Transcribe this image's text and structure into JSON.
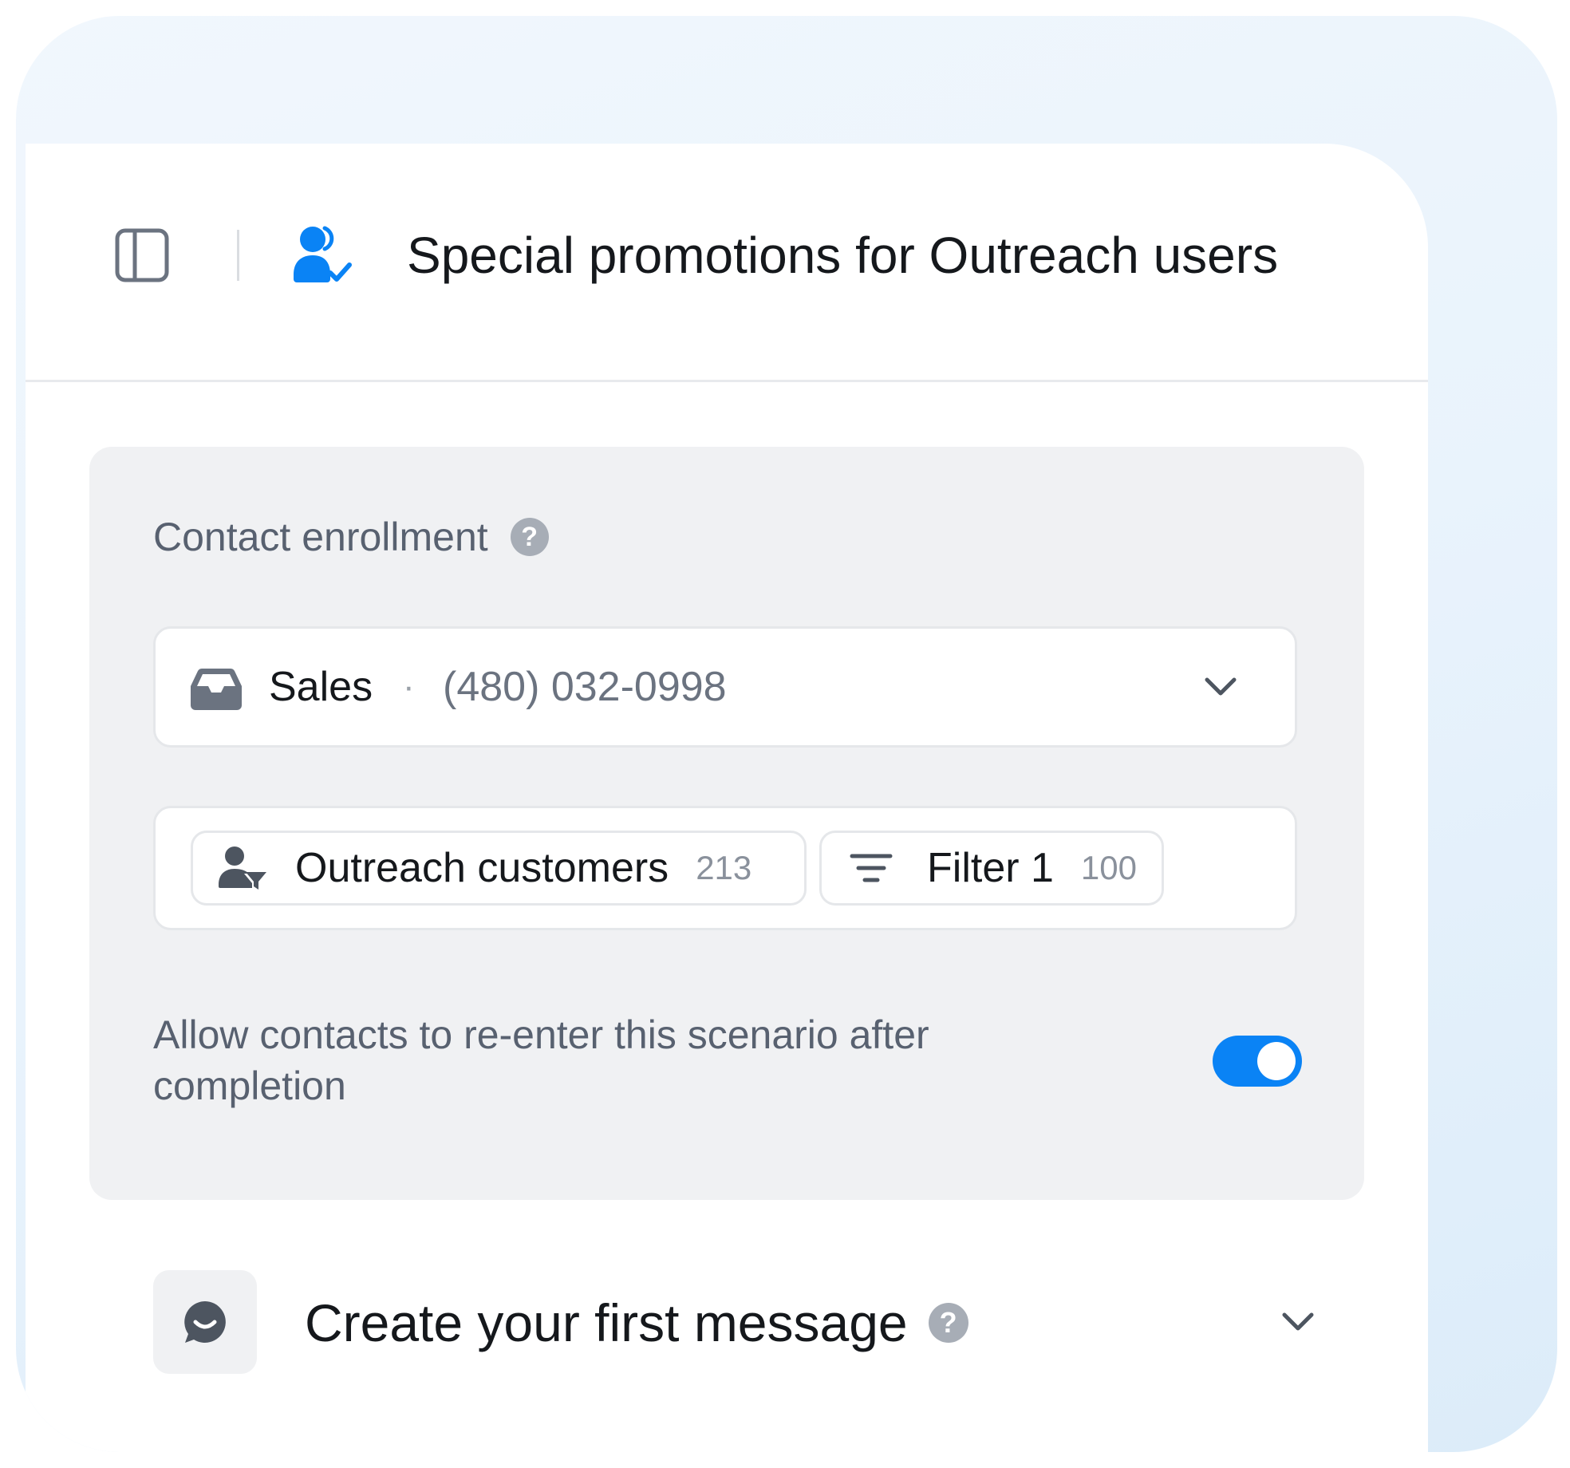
{
  "header": {
    "title": "Special promotions for Outreach users",
    "sidebar_toggle_icon": "sidebar-panel-icon",
    "scenario_icon": "user-check-icon",
    "accent_color": "#0a83f5"
  },
  "enrollment": {
    "section_title": "Contact enrollment",
    "help_glyph": "?",
    "inbox": {
      "icon": "inbox-tray-icon",
      "label": "Sales",
      "separator": "·",
      "phone": "(480) 032-0998"
    },
    "chips": [
      {
        "icon": "user-filter-icon",
        "label": "Outreach customers",
        "count": "213"
      },
      {
        "icon": "filter-lines-icon",
        "label": "Filter 1",
        "count": "100"
      }
    ],
    "reenter_text": "Allow contacts to re-enter this scenario after completion",
    "reenter_enabled": true
  },
  "message": {
    "title": "Create your first message",
    "help_glyph": "?",
    "icon": "chat-smile-icon"
  }
}
